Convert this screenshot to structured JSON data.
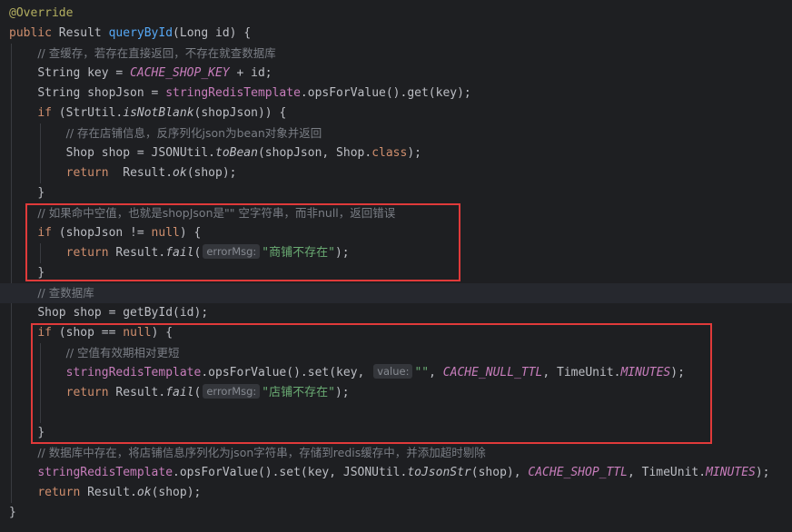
{
  "editor": {
    "lines": {
      "l1": {
        "annotation": "@Override"
      },
      "l2": {
        "kw_public": "public",
        "type": "Result",
        "method": "queryById",
        "params_open": "(Long id) {"
      },
      "l3": {
        "comment": "// 查缓存，若存在直接返回，不存在就查数据库"
      },
      "l4": {
        "a": "String key = ",
        "const": "CACHE_SHOP_KEY",
        "b": " + id;"
      },
      "l5": {
        "a": "String shopJson = ",
        "field": "stringRedisTemplate",
        "b": ".opsForValue().get(key);"
      },
      "l6": {
        "kw_if": "if",
        "a": " (StrUtil.",
        "method": "isNotBlank",
        "b": "(shopJson)) {"
      },
      "l7": {
        "comment": "// 存在店铺信息，反序列化json为bean对象并返回"
      },
      "l8": {
        "a": "Shop shop = JSONUtil.",
        "method": "toBean",
        "b": "(shopJson, Shop.",
        "kw_class": "class",
        "c": ");"
      },
      "l9": {
        "kw_return": "return",
        "a": "  Result.",
        "method": "ok",
        "b": "(shop);"
      },
      "l10": {
        "brace": "}"
      },
      "l11": {
        "comment": "// 如果命中空值，也就是shopJson是\"\" 空字符串，而非null，返回错误"
      },
      "l12": {
        "kw_if": "if",
        "a": " (shopJson != ",
        "kw_null": "null",
        "b": ") {"
      },
      "l13": {
        "kw_return": "return",
        "a": " Result.",
        "method": "fail",
        "b": "(",
        "hint": "errorMsg:",
        "str": "\"商铺不存在\"",
        "c": ");"
      },
      "l14": {
        "brace": "}"
      },
      "l15": {
        "comment": "// 查数据库"
      },
      "l16": {
        "a": "Shop shop = getById(id);"
      },
      "l17": {
        "kw_if": "if",
        "a": " (shop == ",
        "kw_null": "null",
        "b": ") {"
      },
      "l18": {
        "comment": "// 空值有效期相对更短"
      },
      "l19": {
        "field": "stringRedisTemplate",
        "a": ".opsForValue().set(key, ",
        "hint": "value:",
        "str": "\"\"",
        "b": ", ",
        "const1": "CACHE_NULL_TTL",
        "c": ", TimeUnit.",
        "const2": "MINUTES",
        "d": ");"
      },
      "l20": {
        "kw_return": "return",
        "a": " Result.",
        "method": "fail",
        "b": "(",
        "hint": "errorMsg:",
        "str": "\"店铺不存在\"",
        "c": ");"
      },
      "l22": {
        "brace": "}"
      },
      "l23": {
        "comment": "// 数据库中存在，将店铺信息序列化为json字符串，存储到redis缓存中，并添加超时剔除"
      },
      "l24": {
        "field": "stringRedisTemplate",
        "a": ".opsForValue().set(key, JSONUtil.",
        "method": "toJsonStr",
        "b": "(shop), ",
        "const1": "CACHE_SHOP_TTL",
        "c": ", TimeUnit.",
        "const2": "MINUTES",
        "d": ");"
      },
      "l25": {
        "kw_return": "return",
        "a": " Result.",
        "method": "ok",
        "b": "(shop);"
      },
      "l26": {
        "brace": "}"
      }
    }
  },
  "colors": {
    "background": "#1e1f22",
    "highlight_box": "#e03a3a",
    "keyword": "#cf8e6d",
    "method_decl": "#56a8f5",
    "constant": "#c77dbb",
    "string": "#6aab73",
    "comment": "#7a7e85",
    "annotation": "#b3ae60"
  }
}
